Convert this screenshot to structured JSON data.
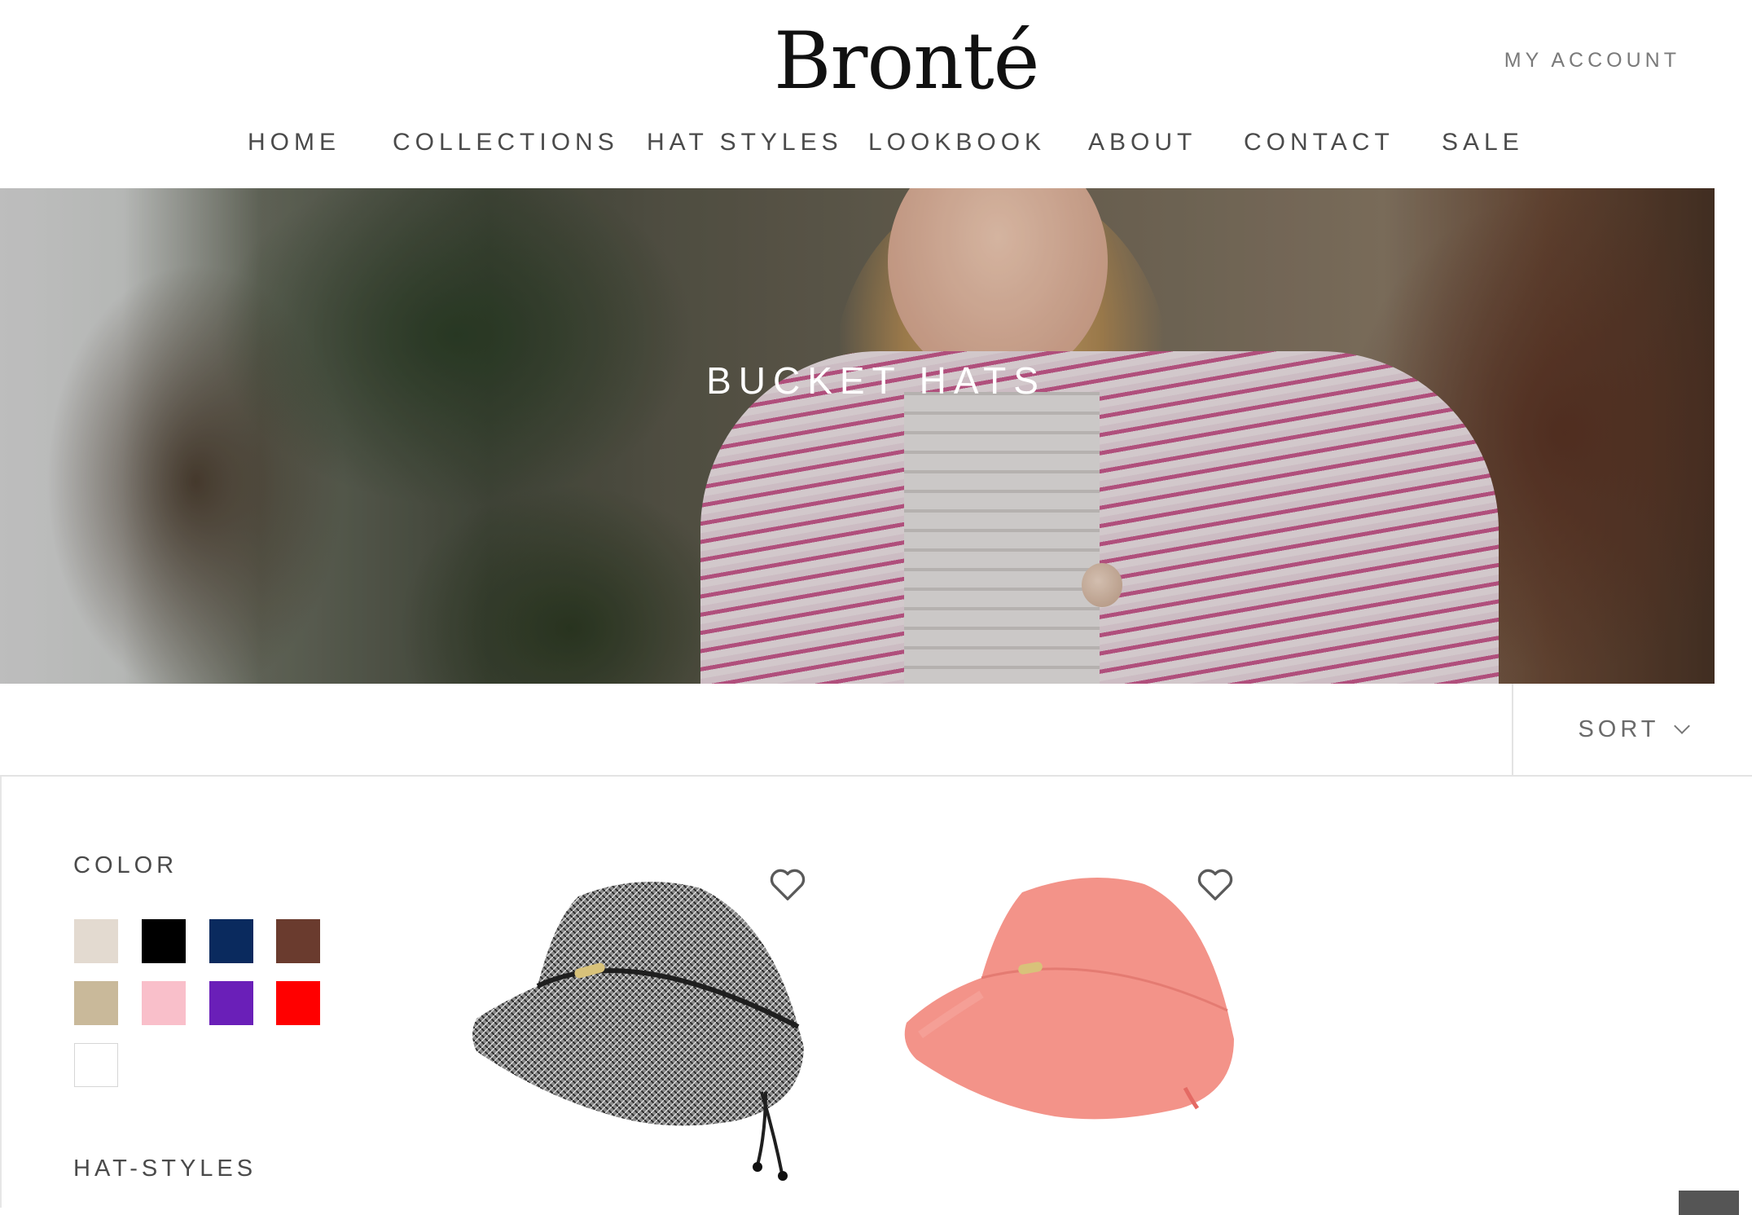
{
  "header": {
    "logo": "Bronté",
    "account_label": "MY ACCOUNT",
    "nav": [
      "HOME",
      "COLLECTIONS",
      "HAT STYLES",
      "LOOKBOOK",
      "ABOUT",
      "CONTACT",
      "SALE"
    ]
  },
  "hero": {
    "title": "BUCKET HATS"
  },
  "toolbar": {
    "sort_label": "SORT"
  },
  "filters": {
    "color_title": "COLOR",
    "colors": [
      "#e3dad0",
      "#000000",
      "#0a2a5e",
      "#6a3b2e",
      "#c9b99a",
      "#f9bfca",
      "#6a1fb8",
      "#ff0000",
      "#ffffff"
    ],
    "hat_styles_title": "HAT-STYLES"
  },
  "products": [
    {
      "icon": "wishlist-heart-icon",
      "color": "#6f6f6f"
    },
    {
      "icon": "wishlist-heart-icon",
      "color": "#f39389"
    }
  ]
}
